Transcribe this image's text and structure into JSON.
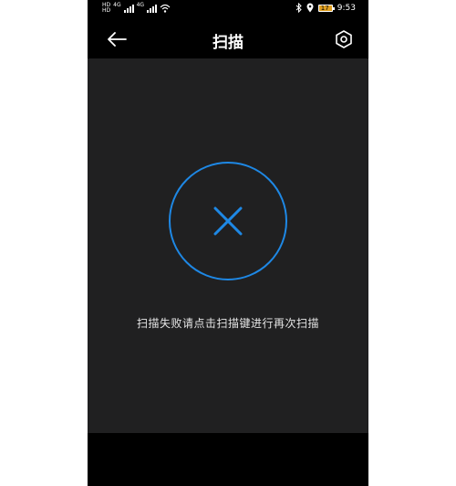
{
  "status_bar": {
    "sim1_label": "HD",
    "sim2_label": "HD",
    "network1": "4G",
    "network2": "4G",
    "battery_level": "17",
    "time": "9:53"
  },
  "nav": {
    "title": "扫描",
    "back_icon": "back-arrow-icon",
    "settings_icon": "hexagon-settings-icon"
  },
  "scan_result": {
    "status_icon": "close-x-icon",
    "accent_color": "#1e88e5",
    "message": "扫描失败请点击扫描键进行再次扫描"
  }
}
